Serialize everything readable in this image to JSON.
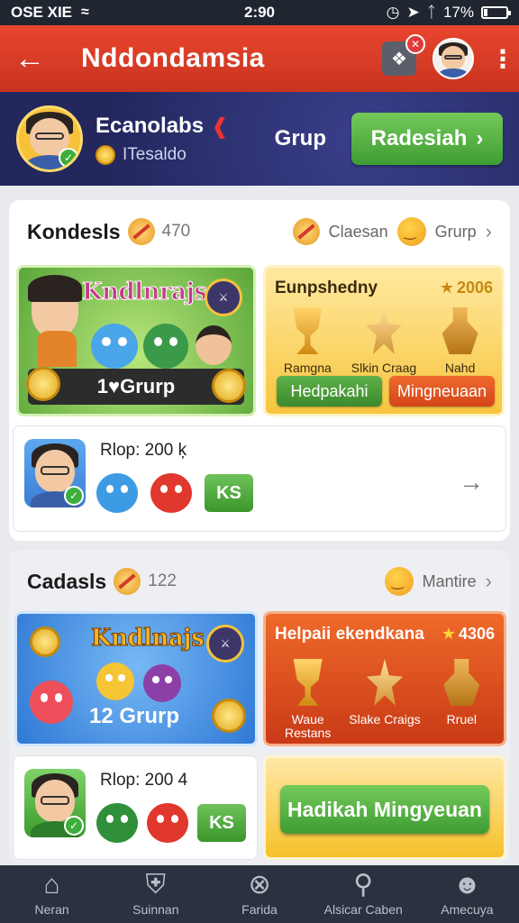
{
  "status_bar": {
    "carrier": "OSE XIE",
    "time": "2:90",
    "battery_text": "17%",
    "battery_level": 0.17
  },
  "header": {
    "title": "Nddondamsia"
  },
  "banner": {
    "name": "Ecanolabs",
    "subtitle": "ITesaldo",
    "group_label": "Grup",
    "button_label": "Radesiah"
  },
  "section1": {
    "title": "Kondesls",
    "count": "470",
    "link1": "Claesan",
    "link2": "Grurp",
    "promo": {
      "title": "Kndlnrajs",
      "footer": "1♥Grurp"
    },
    "panel": {
      "title": "Eunpshedny",
      "score": "2006",
      "items": [
        "Ramgna",
        "Slkin Craag",
        "Nahd"
      ],
      "button_green": "Hedpakahi",
      "button_orange": "Mingneuaan"
    },
    "row": {
      "label": "Rlop: 200 ķ",
      "ks": "KS"
    }
  },
  "section2": {
    "title": "Cadasls",
    "count": "122",
    "link": "Mantire",
    "promo": {
      "title": "Kndlnajs",
      "footer": "12 Grurp"
    },
    "panel": {
      "title": "Helpaii ekendkana",
      "score": "4306",
      "items": [
        "Waue Restans",
        "Slake Craigs",
        "Rruel"
      ]
    },
    "row": {
      "label": "Rlop: 200 4",
      "ks": "KS"
    },
    "cta": "Hadikah Mingyeuan"
  },
  "nav": {
    "items": [
      {
        "label": "Neran",
        "icon": "home-icon"
      },
      {
        "label": "Suinnan",
        "icon": "shield-icon"
      },
      {
        "label": "Farida",
        "icon": "close-circle-icon"
      },
      {
        "label": "Alsicar Caben",
        "icon": "search-icon"
      },
      {
        "label": "Amecuya",
        "icon": "person-icon"
      }
    ]
  },
  "colors": {
    "header_red": "#e8452e",
    "banner_navy": "#23275e",
    "green": "#3f9d33",
    "orange": "#d4451a",
    "nav_bg": "#2a3240"
  }
}
